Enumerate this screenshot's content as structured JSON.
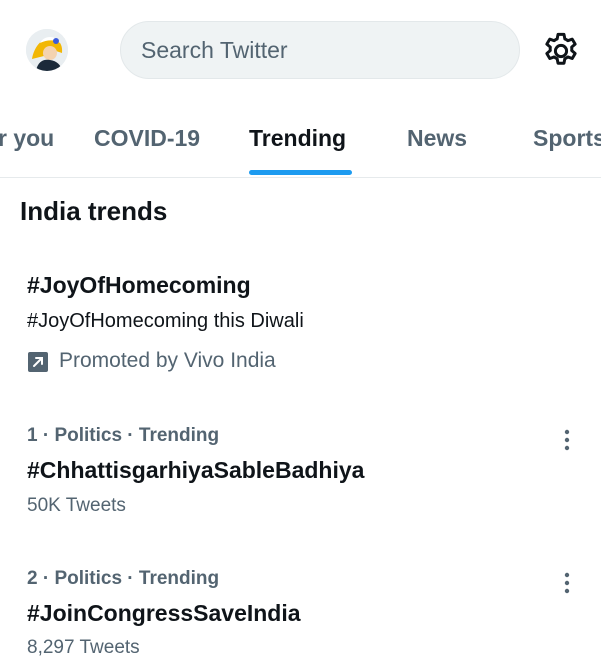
{
  "header": {
    "search_placeholder": "Search Twitter"
  },
  "tabs": [
    {
      "label": "r you",
      "active": false
    },
    {
      "label": "COVID-19",
      "active": false
    },
    {
      "label": "Trending",
      "active": true
    },
    {
      "label": "News",
      "active": false
    },
    {
      "label": "Sports",
      "active": false
    }
  ],
  "section": {
    "title": "India trends"
  },
  "promoted_trend": {
    "title": "#JoyOfHomecoming",
    "description": "#JoyOfHomecoming this Diwali",
    "promoted_label": "Promoted by Vivo India"
  },
  "trends": [
    {
      "meta": "1 · Politics · Trending",
      "title": "#ChhattisgarhiyaSableBadhiya",
      "count": "50K Tweets"
    },
    {
      "meta": "2 · Politics · Trending",
      "title": "#JoinCongressSaveIndia",
      "count": "8,297 Tweets"
    }
  ],
  "colors": {
    "accent": "#1d9bf0",
    "text_primary": "#0f1419",
    "text_secondary": "#536471",
    "search_bg": "#eff3f4"
  },
  "icons": {
    "settings": "gear-icon",
    "promoted": "promoted-arrow-icon",
    "more": "more-vertical-icon"
  }
}
